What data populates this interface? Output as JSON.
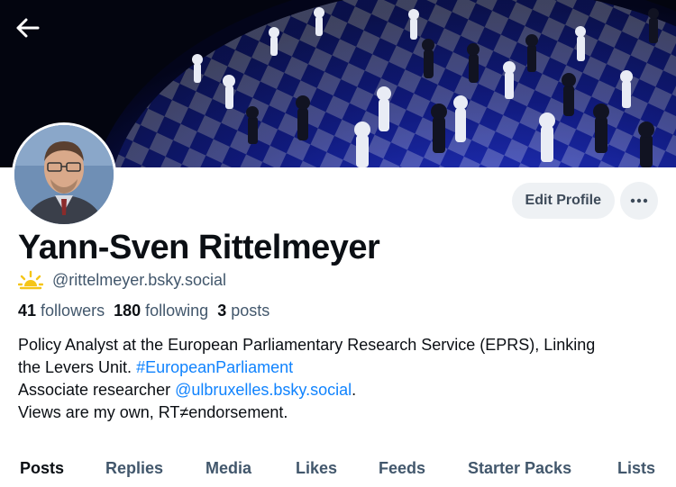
{
  "header": {
    "back_icon": "arrow-left-icon",
    "banner_image": "chess-board-globe-banner"
  },
  "profile": {
    "avatar": "profile-photo-man-glasses",
    "display_name": "Yann-Sven Rittelmeyer",
    "handle_icon": "sunrise-icon",
    "handle": "@rittelmeyer.bsky.social",
    "stats": {
      "followers_count": "41",
      "followers_label": "followers",
      "following_count": "180",
      "following_label": "following",
      "posts_count": "3",
      "posts_label": "posts"
    },
    "bio": {
      "line1": "Policy Analyst at the European Parliamentary Research Service (EPRS), Linking",
      "line2_text": "the Levers Unit. ",
      "line2_hashtag": "#EuropeanParliament",
      "line3_text": "Associate researcher ",
      "line3_mention": "@ulbruxelles.bsky.social",
      "line3_end": ".",
      "line4": "Views are my own, RT≠endorsement."
    }
  },
  "actions": {
    "edit_profile_label": "Edit Profile",
    "more_icon": "ellipsis-icon"
  },
  "tabs": [
    {
      "label": "Posts",
      "active": true
    },
    {
      "label": "Replies",
      "active": false
    },
    {
      "label": "Media",
      "active": false
    },
    {
      "label": "Likes",
      "active": false
    },
    {
      "label": "Feeds",
      "active": false
    },
    {
      "label": "Starter Packs",
      "active": false
    },
    {
      "label": "Lists",
      "active": false
    }
  ],
  "colors": {
    "link": "#1083fe",
    "muted_text": "#42576c",
    "button_bg": "#eef1f4"
  }
}
